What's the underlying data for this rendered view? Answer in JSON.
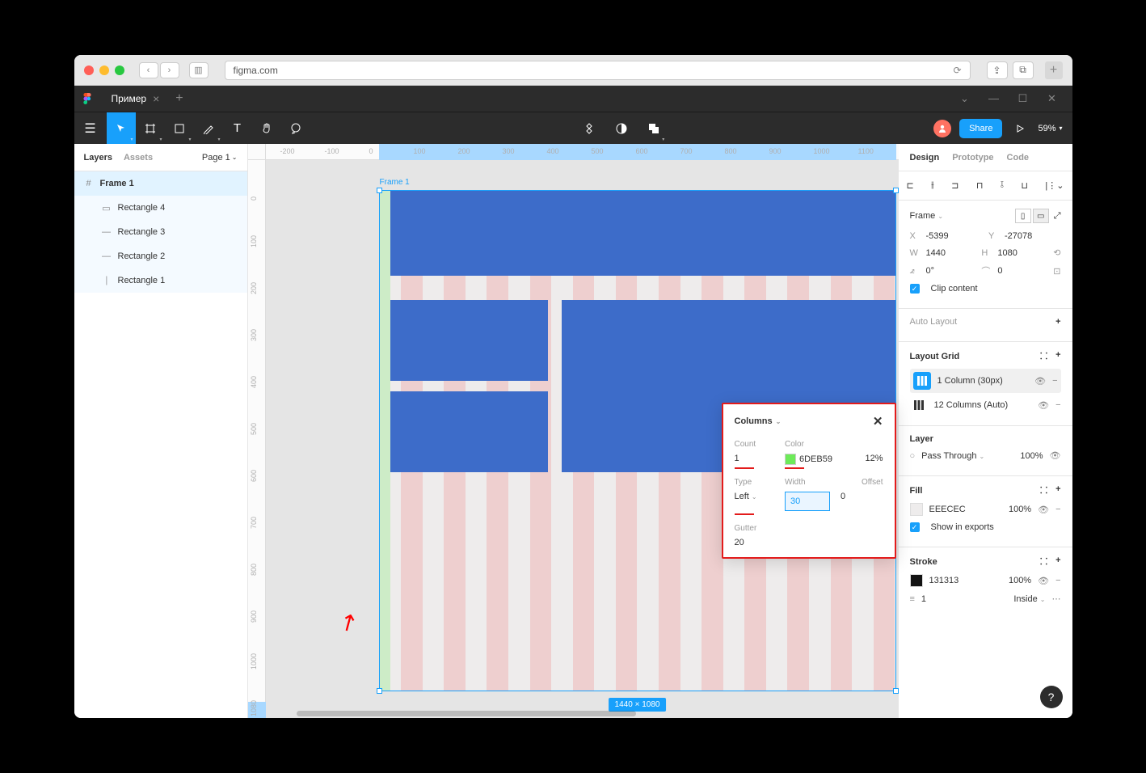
{
  "browser": {
    "url": "figma.com"
  },
  "file_tab": {
    "name": "Пример"
  },
  "toolbar": {
    "share": "Share",
    "zoom": "59%"
  },
  "left_panel": {
    "tabs": {
      "layers": "Layers",
      "assets": "Assets"
    },
    "page": "Page 1",
    "layers": [
      {
        "name": "Frame 1",
        "type": "frame",
        "selected": true
      },
      {
        "name": "Rectangle 4",
        "type": "rect"
      },
      {
        "name": "Rectangle 3",
        "type": "rect"
      },
      {
        "name": "Rectangle 2",
        "type": "rect"
      },
      {
        "name": "Rectangle 1",
        "type": "rect"
      }
    ]
  },
  "canvas": {
    "frame_label": "Frame 1",
    "dimensions": "1440 × 1080",
    "ruler_h": [
      "-200",
      "-100",
      "0",
      "100",
      "200",
      "300",
      "400",
      "500",
      "600",
      "700",
      "800",
      "900",
      "1000",
      "1100"
    ],
    "ruler_v": [
      "0",
      "100",
      "200",
      "300",
      "400",
      "500",
      "600",
      "700",
      "800",
      "900",
      "1000",
      "1080"
    ]
  },
  "popup": {
    "title": "Columns",
    "labels": {
      "count": "Count",
      "color": "Color",
      "type": "Type",
      "width": "Width",
      "offset": "Offset",
      "gutter": "Gutter"
    },
    "count": "1",
    "color_hex": "6DEB59",
    "color_opacity": "12%",
    "type": "Left",
    "width": "30",
    "offset": "0",
    "gutter": "20"
  },
  "right_panel": {
    "tabs": {
      "design": "Design",
      "prototype": "Prototype",
      "code": "Code"
    },
    "frame": {
      "label": "Frame",
      "x_label": "X",
      "x": "-5399",
      "y_label": "Y",
      "y": "-27078",
      "w_label": "W",
      "w": "1440",
      "h_label": "H",
      "h": "1080",
      "rotation": "0°",
      "radius": "0",
      "clip": "Clip content"
    },
    "auto_layout": "Auto Layout",
    "layout_grid": {
      "title": "Layout Grid",
      "items": [
        {
          "label": "1 Column (30px)",
          "active": true
        },
        {
          "label": "12 Columns (Auto)",
          "active": false
        }
      ]
    },
    "layer": {
      "title": "Layer",
      "blend": "Pass Through",
      "opacity": "100%"
    },
    "fill": {
      "title": "Fill",
      "hex": "EEECEC",
      "opacity": "100%",
      "show_exports": "Show in exports"
    },
    "stroke": {
      "title": "Stroke",
      "hex": "131313",
      "opacity": "100%",
      "weight": "1",
      "position": "Inside"
    }
  }
}
